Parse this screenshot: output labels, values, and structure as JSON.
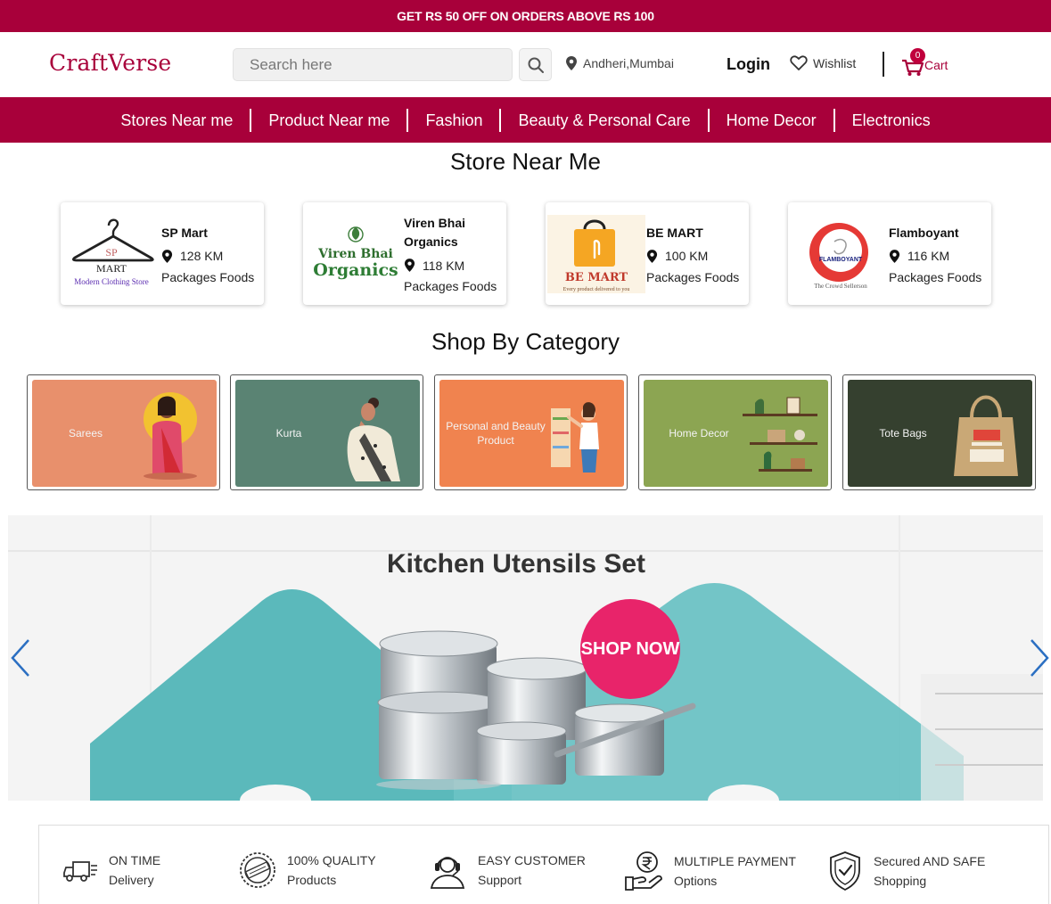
{
  "promo": {
    "text": "GET RS 50 OFF ON ORDERS ABOVE RS 100"
  },
  "header": {
    "logo": "CraftVerse",
    "search_placeholder": "Search here",
    "location": "Andheri,Mumbai",
    "login": "Login",
    "wishlist": "Wishlist",
    "cart_label": "Cart",
    "cart_count": "0"
  },
  "nav": {
    "items": [
      {
        "label": "Stores Near me"
      },
      {
        "label": "Product Near me"
      },
      {
        "label": "Fashion"
      },
      {
        "label": "Beauty & Personal Care"
      },
      {
        "label": "Home Decor"
      },
      {
        "label": "Electronics"
      }
    ]
  },
  "stores": {
    "title": "Store Near Me",
    "items": [
      {
        "name": "SP Mart",
        "distance": "128 KM",
        "category": "Packages Foods",
        "logo_text": "SP",
        "logo_sub": "MART",
        "logo_tagline": "Modern Clothing Store"
      },
      {
        "name": "Viren Bhai Organics",
        "distance": "118 KM",
        "category": "Packages Foods",
        "logo_text": "Viren Bhai",
        "logo_sub": "Organics"
      },
      {
        "name": "BE MART",
        "distance": "100 KM",
        "category": "Packages Foods",
        "logo_text": "BE MART",
        "logo_tagline": "Every product delivered to you"
      },
      {
        "name": "Flamboyant",
        "distance": "116 KM",
        "category": "Packages Foods",
        "logo_text": "FLAMBOYANT",
        "logo_tagline": "The Crowd Sellerson"
      }
    ]
  },
  "categories": {
    "title": "Shop By Category",
    "items": [
      {
        "label": "Sarees",
        "color": "#e8906c"
      },
      {
        "label": "Kurta",
        "color": "#5a8373"
      },
      {
        "label": "Personal and Beauty Product",
        "color": "#f0834f"
      },
      {
        "label": "Home Decor",
        "color": "#8ca552"
      },
      {
        "label": "Tote Bags",
        "color": "#35402f"
      }
    ]
  },
  "banner": {
    "title": "Kitchen Utensils Set",
    "cta": "SHOP NOW"
  },
  "features": [
    {
      "line1": "ON TIME",
      "line2": "Delivery",
      "icon": "delivery-truck-icon"
    },
    {
      "line1": "100% QUALITY",
      "line2": "Products",
      "icon": "approved-badge-icon"
    },
    {
      "line1": "EASY CUSTOMER",
      "line2": "Support",
      "icon": "support-headset-icon"
    },
    {
      "line1": "MULTIPLE PAYMENT",
      "line2": "Options",
      "icon": "rupee-hand-icon"
    },
    {
      "line1": "Secured AND SAFE",
      "line2": "Shopping",
      "icon": "shield-check-icon"
    }
  ],
  "colors": {
    "brand": "#a8003a",
    "cta": "#e8246a",
    "teal": "#5fbfbf"
  }
}
